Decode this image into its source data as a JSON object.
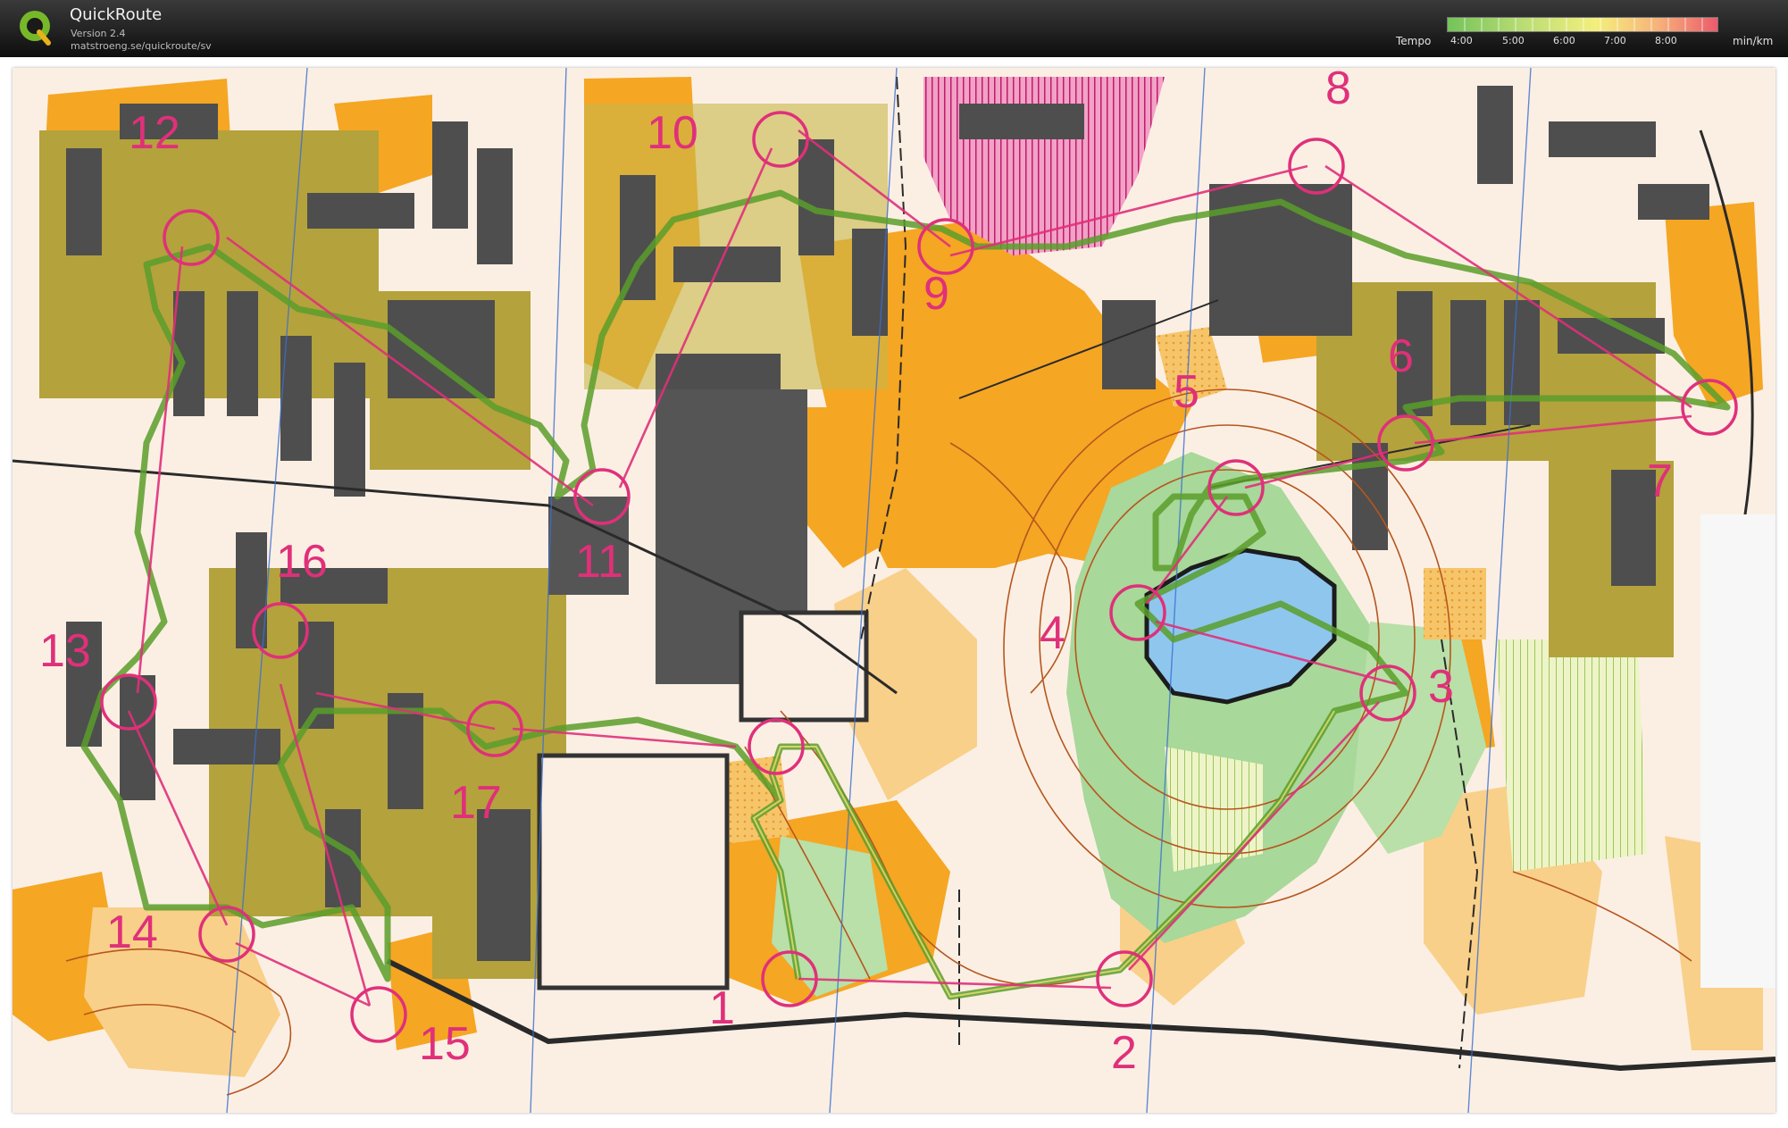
{
  "app": {
    "name": "QuickRoute",
    "version": "Version 2.4",
    "url": "matstroeng.se/quickroute/sv"
  },
  "legend": {
    "title": "Tempo",
    "ticks": [
      "4:00",
      "5:00",
      "6:00",
      "7:00",
      "8:00"
    ],
    "unit": "min/km",
    "colors": {
      "fast": "#74c35a",
      "mid": "#f4ef7d",
      "slow": "#ec5b6b"
    }
  },
  "map": {
    "course_color": "#e0307a",
    "route_color": "#5a9e2a",
    "controls": [
      {
        "label": "1"
      },
      {
        "label": "2"
      },
      {
        "label": "3"
      },
      {
        "label": "4"
      },
      {
        "label": "5"
      },
      {
        "label": "6"
      },
      {
        "label": "7"
      },
      {
        "label": "8"
      },
      {
        "label": "9"
      },
      {
        "label": "10"
      },
      {
        "label": "11"
      },
      {
        "label": "12"
      },
      {
        "label": "13"
      },
      {
        "label": "14"
      },
      {
        "label": "15"
      },
      {
        "label": "16"
      },
      {
        "label": "17"
      }
    ]
  }
}
